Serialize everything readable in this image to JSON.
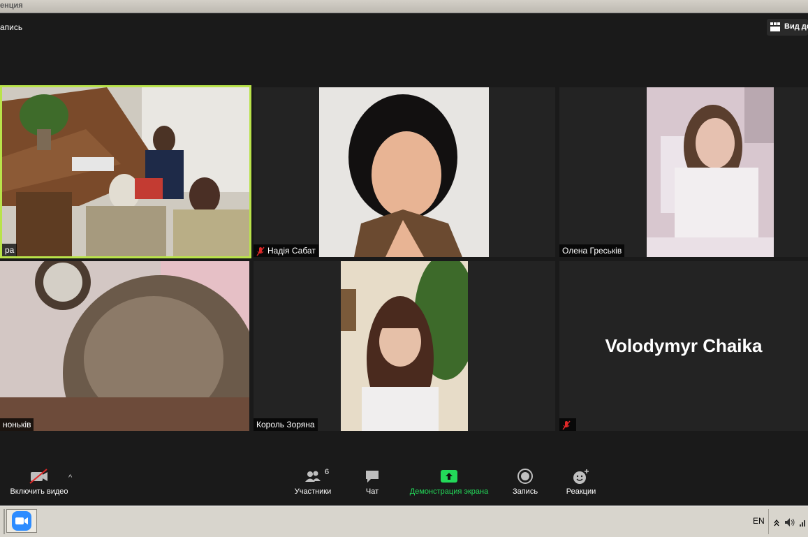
{
  "window": {
    "title": "енция"
  },
  "header": {
    "record_label": "апись",
    "view_label": "Вид до"
  },
  "tiles": [
    {
      "name": "ра",
      "muted": false,
      "type": "video",
      "active_speaker": true
    },
    {
      "name": "Надія Сабат",
      "muted": true,
      "type": "video"
    },
    {
      "name": "Олена Греськів",
      "muted": false,
      "type": "video"
    },
    {
      "name": "ноньків",
      "muted": false,
      "type": "video"
    },
    {
      "name": "Король Зоряна",
      "muted": false,
      "type": "video"
    },
    {
      "name": "",
      "muted": true,
      "type": "name-only",
      "display_name": "Volodymyr Chaika"
    }
  ],
  "toolbar": {
    "video_label": "Включить видео",
    "participants_label": "Участники",
    "participants_count": "6",
    "chat_label": "Чат",
    "share_label": "Демонстрация экрана",
    "record_label": "Запись",
    "reactions_label": "Реакции",
    "caret": "^"
  },
  "taskbar": {
    "language": "EN"
  },
  "colors": {
    "active_border": "#b9e34a",
    "share_green": "#23d959",
    "muted_red": "#e02828",
    "zoom_blue": "#2d8cff"
  }
}
